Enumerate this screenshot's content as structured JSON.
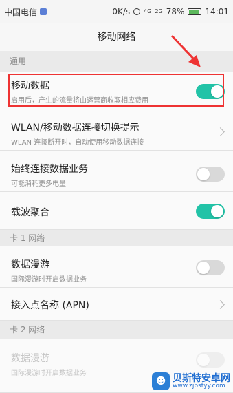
{
  "status": {
    "carrier": "中国电信",
    "speed": "0K/s",
    "network": "4G",
    "network_sub": "2G",
    "battery": "78%",
    "time": "14:01"
  },
  "header": {
    "title": "移动网络"
  },
  "sections": {
    "general": "通用",
    "card1": "卡 1 网络",
    "card2": "卡 2 网络"
  },
  "rows": {
    "mobile_data": {
      "title": "移动数据",
      "sub": "启用后，产生的流量将由运营商收取相应费用",
      "toggle_on": true
    },
    "wlan_switch": {
      "title": "WLAN/移动数据连接切换提示",
      "sub": "WLAN 连接断开时，自动使用移动数据连接"
    },
    "always_on": {
      "title": "始终连接数据业务",
      "sub": "可能消耗更多电量",
      "toggle_on": false
    },
    "carrier_aggregation": {
      "title": "载波聚合",
      "toggle_on": true
    },
    "roaming1": {
      "title": "数据漫游",
      "sub": "国际漫游时开启数据业务",
      "toggle_on": false
    },
    "apn1": {
      "title": "接入点名称 (APN)"
    },
    "roaming2": {
      "title": "数据漫游",
      "sub": "国际漫游时开启数据业务",
      "toggle_on": false
    }
  },
  "watermark": {
    "name": "贝斯特安卓网",
    "url": "www.zjbstyy.com"
  }
}
